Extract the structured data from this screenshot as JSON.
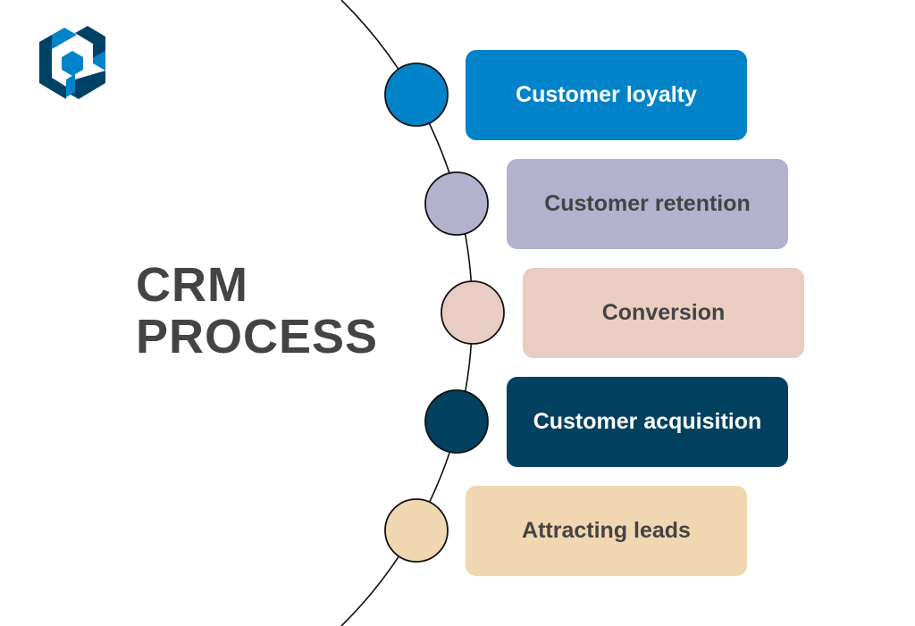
{
  "title": {
    "line1": "CRM",
    "line2": "PROCESS"
  },
  "logo": {
    "icon": "hexagon-cube-p-logo-icon",
    "colors": {
      "dark": "#004266",
      "light": "#0083c8"
    }
  },
  "steps": [
    {
      "label": "Customer loyalty",
      "fill": "#0083c8",
      "text_color": "#ffffff"
    },
    {
      "label": "Customer retention",
      "fill": "#b2b2cf",
      "text_color": "#444444"
    },
    {
      "label": "Conversion",
      "fill": "#e9cdc3",
      "text_color": "#444444"
    },
    {
      "label": "Customer acquisition",
      "fill": "#02415f",
      "text_color": "#ffffff"
    },
    {
      "label": "Attracting leads",
      "fill": "#f0d6b1",
      "text_color": "#444444"
    }
  ]
}
